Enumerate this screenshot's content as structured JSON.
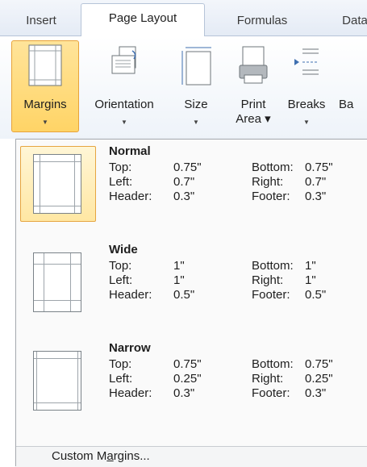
{
  "tabs": [
    {
      "label": "Insert"
    },
    {
      "label": "Page Layout"
    },
    {
      "label": "Formulas"
    },
    {
      "label": "Data"
    }
  ],
  "ribbon": {
    "margins": {
      "label": "Margins",
      "icon": "margins-icon"
    },
    "orientation": {
      "label": "Orientation",
      "icon": "orientation-icon"
    },
    "size": {
      "label": "Size",
      "icon": "size-icon"
    },
    "print_area": {
      "label_line1": "Print",
      "label_line2": "Area ▾",
      "icon": "print-area-icon"
    },
    "breaks": {
      "label": "Breaks",
      "icon": "breaks-icon"
    },
    "background": {
      "label": "Ba"
    }
  },
  "presets": [
    {
      "name": "Normal",
      "top_label": "Top:",
      "top": "0.75\"",
      "bottom_label": "Bottom:",
      "bottom": "0.75\"",
      "left_label": "Left:",
      "left": "0.7\"",
      "right_label": "Right:",
      "right": "0.7\"",
      "header_label": "Header:",
      "header": "0.3\"",
      "footer_label": "Footer:",
      "footer": "0.3\""
    },
    {
      "name": "Wide",
      "top_label": "Top:",
      "top": "1\"",
      "bottom_label": "Bottom:",
      "bottom": "1\"",
      "left_label": "Left:",
      "left": "1\"",
      "right_label": "Right:",
      "right": "1\"",
      "header_label": "Header:",
      "header": "0.5\"",
      "footer_label": "Footer:",
      "footer": "0.5\""
    },
    {
      "name": "Narrow",
      "top_label": "Top:",
      "top": "0.75\"",
      "bottom_label": "Bottom:",
      "bottom": "0.75\"",
      "left_label": "Left:",
      "left": "0.25\"",
      "right_label": "Right:",
      "right": "0.25\"",
      "header_label": "Header:",
      "header": "0.3\"",
      "footer_label": "Footer:",
      "footer": "0.3\""
    }
  ],
  "custom_margins": {
    "before": "Custom M",
    "accel": "a",
    "after": "rgins..."
  },
  "colors": {
    "highlight": "#ffe7a3",
    "highlight_border": "#e6a541",
    "ribbon_border": "#b6c4d8"
  }
}
